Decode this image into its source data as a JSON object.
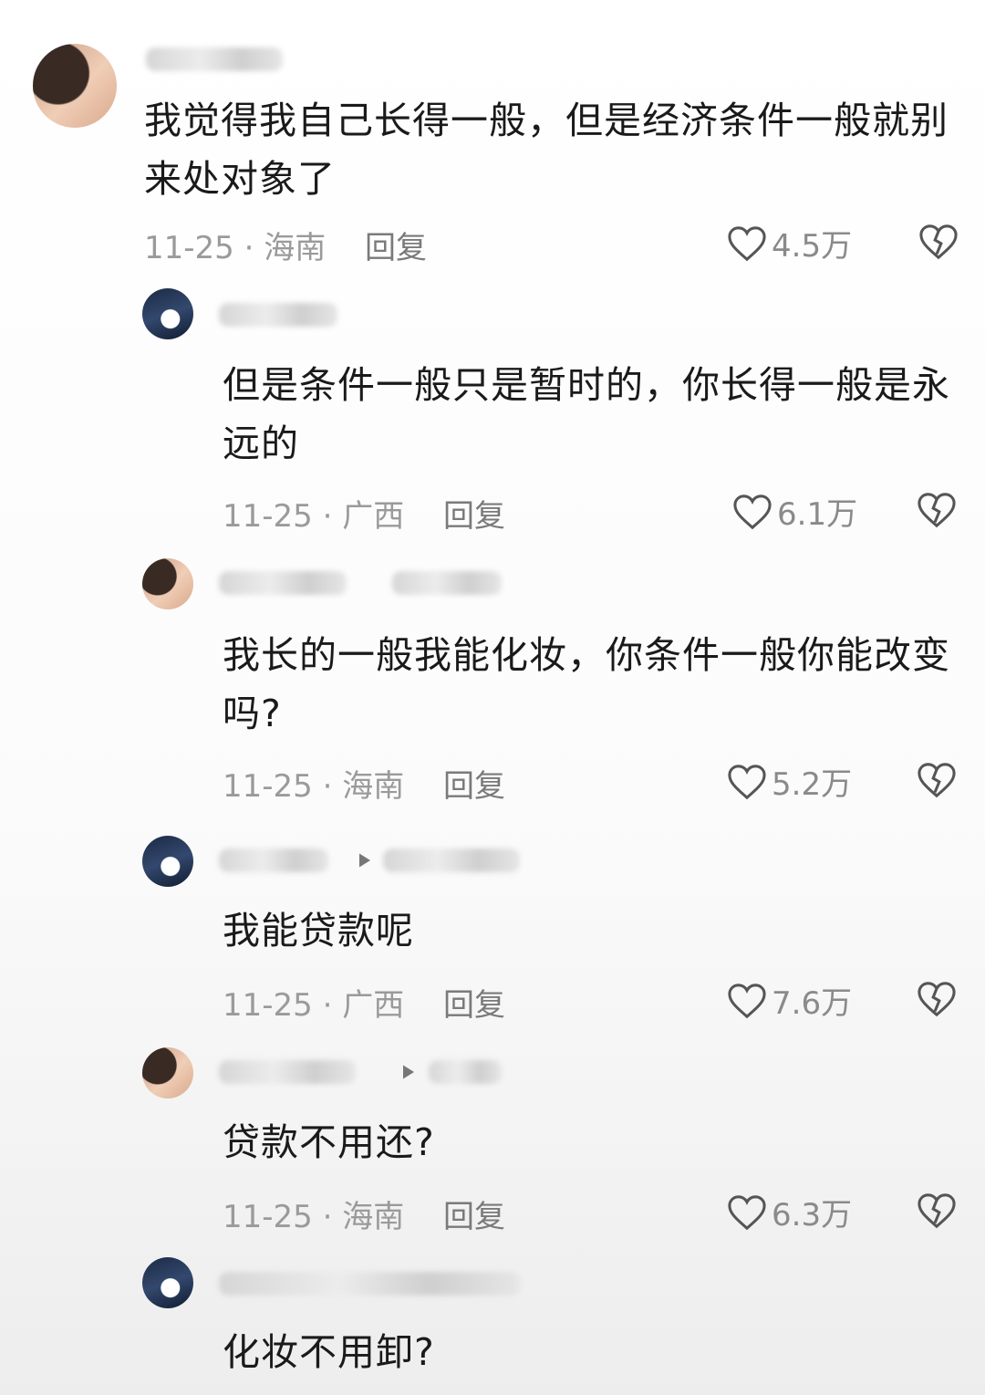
{
  "comments": [
    {
      "text": "我觉得我自己长得一般，但是经济条件一般就别来处对象了",
      "date": "11-25 · 海南",
      "reply": "回复",
      "likes": "4.5万"
    },
    {
      "text": "但是条件一般只是暂时的，你长得一般是永远的",
      "date": "11-25 · 广西",
      "reply": "回复",
      "likes": "6.1万"
    },
    {
      "text": "我长的一般我能化妆，你条件一般你能改变吗?",
      "date": "11-25 · 海南",
      "reply": "回复",
      "likes": "5.2万"
    },
    {
      "text": "我能贷款呢",
      "date": "11-25 · 广西",
      "reply": "回复",
      "likes": "7.6万"
    },
    {
      "text": "贷款不用还?",
      "date": "11-25 · 海南",
      "reply": "回复",
      "likes": "6.3万"
    },
    {
      "text": "化妆不用卸?"
    }
  ],
  "icons": {
    "like": "heart-outline-icon",
    "dislike": "broken-heart-icon",
    "reply-arrow": "play-arrow-icon"
  },
  "colors": {
    "text": "#1a1a1a",
    "meta": "#9a9a9a",
    "icon": "#555555"
  }
}
